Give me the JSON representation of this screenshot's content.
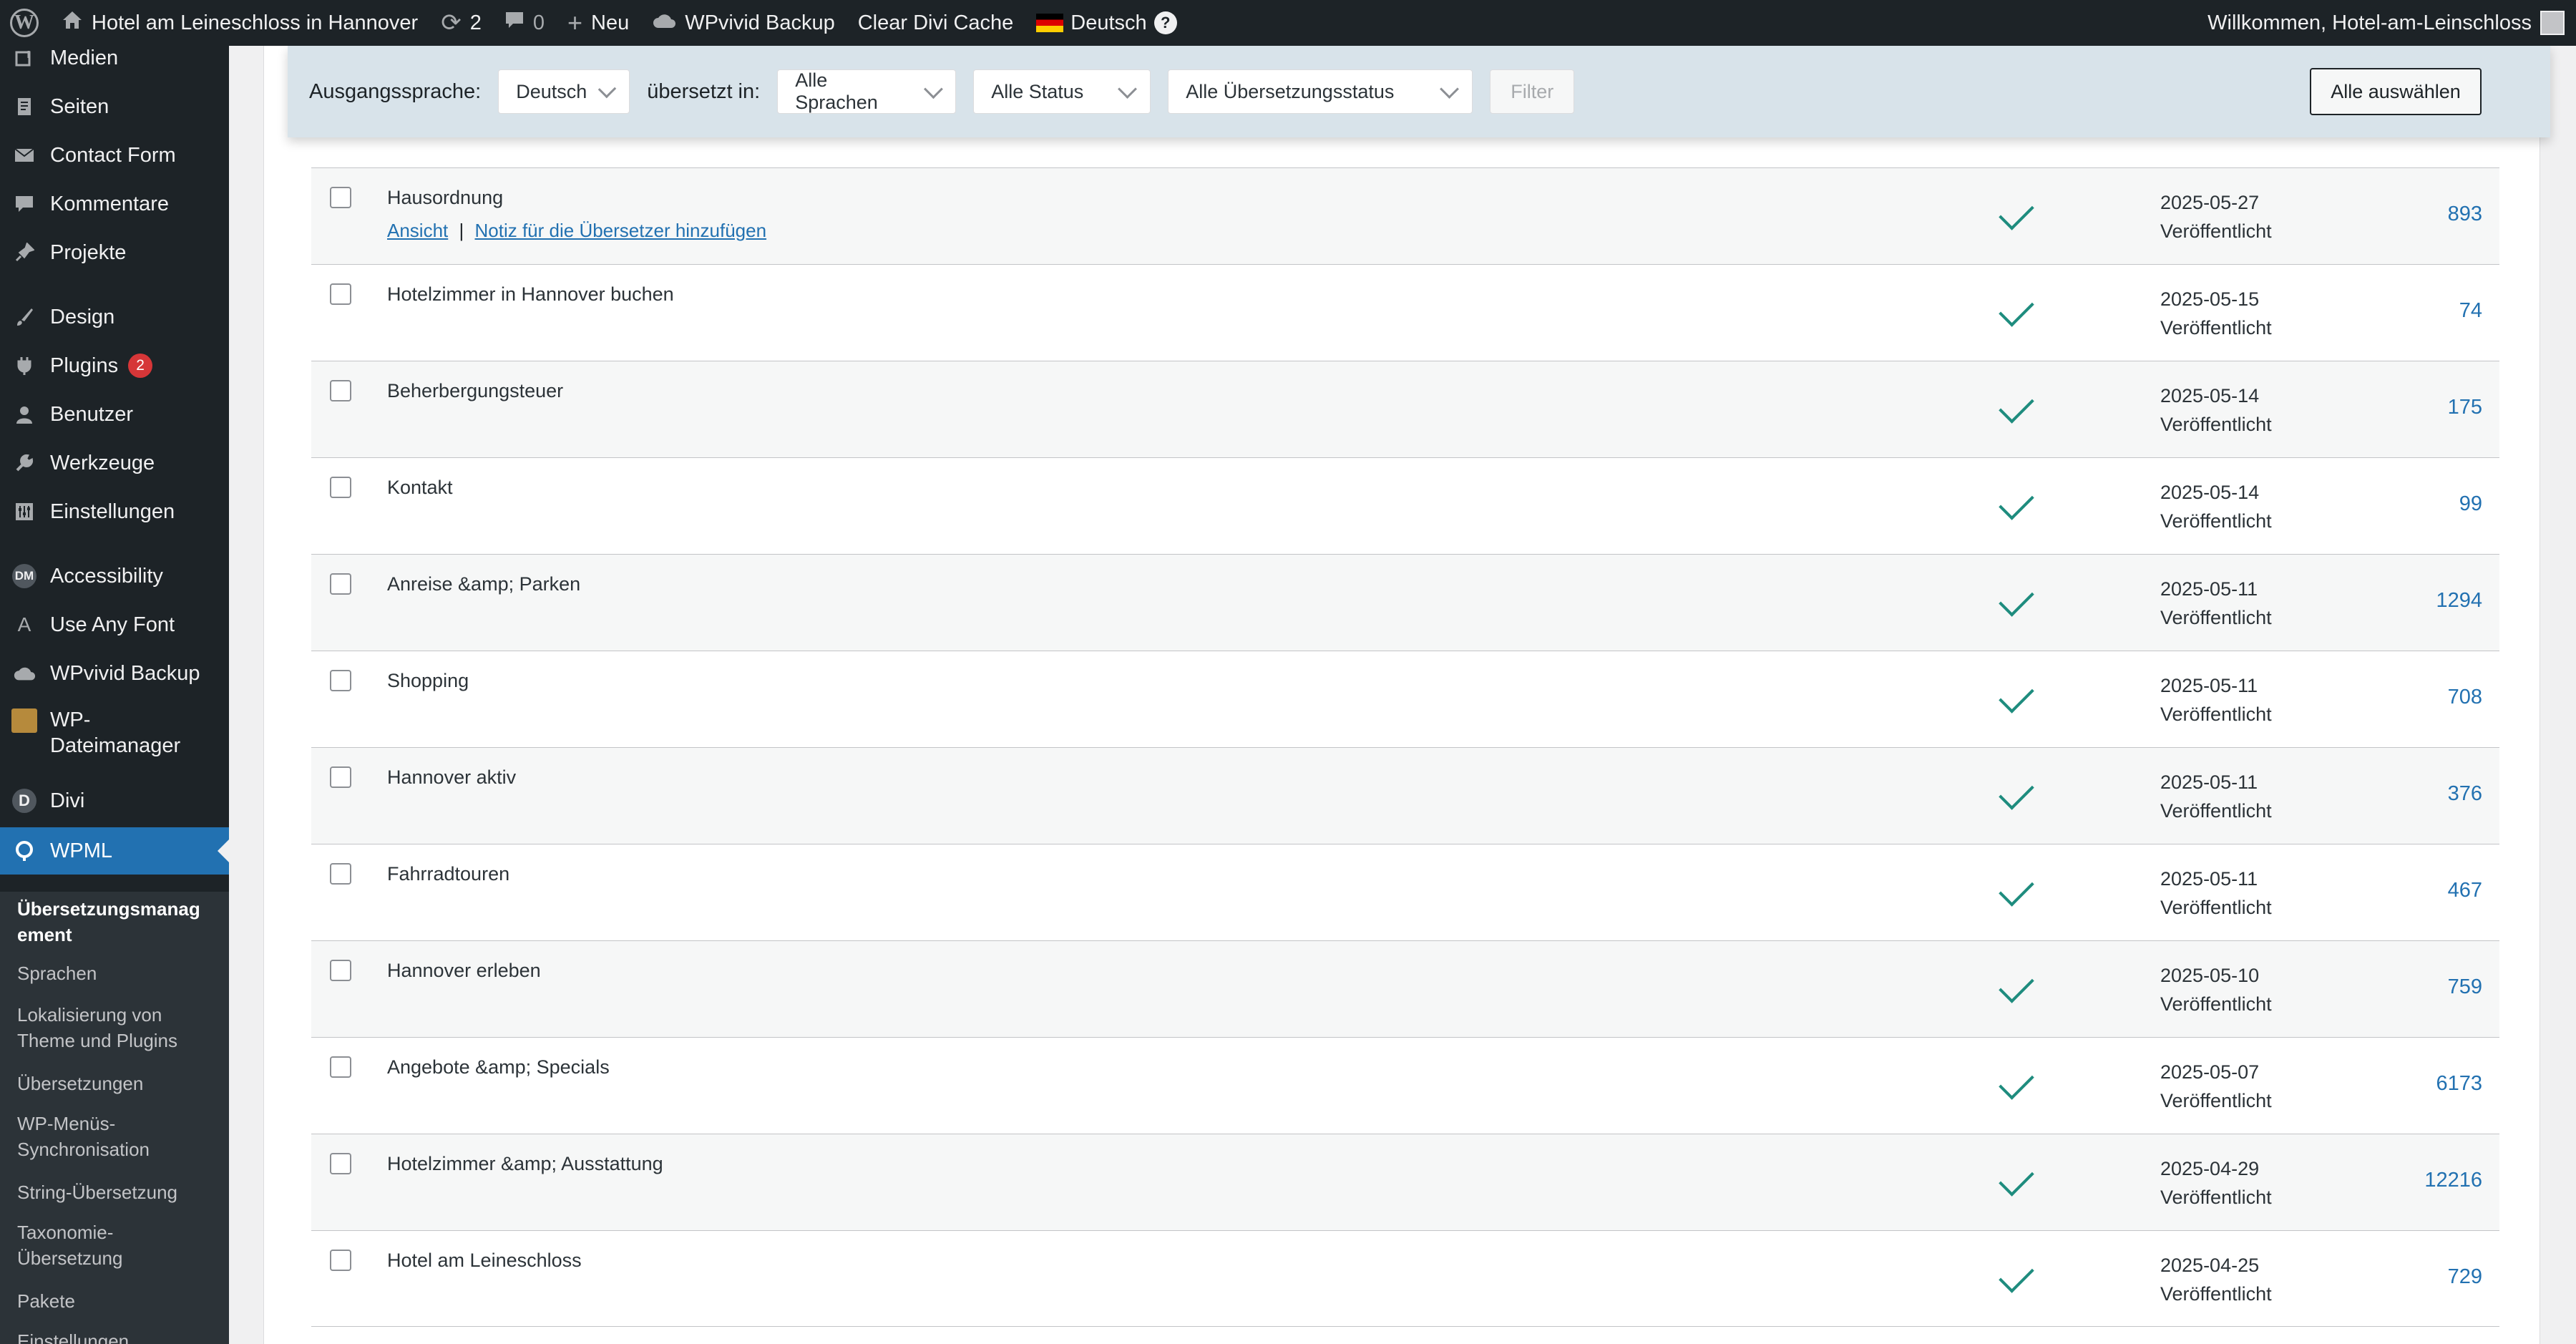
{
  "adminbar": {
    "site_name": "Hotel am Leineschloss in Hannover",
    "updates_count": "2",
    "comments_count": "0",
    "new_label": "Neu",
    "backup_label": "WPvivid Backup",
    "cache_label": "Clear Divi Cache",
    "language_label": "Deutsch",
    "help_label": "?",
    "welcome": "Willkommen, Hotel-am-Leinschloss"
  },
  "sidebar": {
    "items": [
      {
        "label": "Medien",
        "icon": "media-icon"
      },
      {
        "label": "Seiten",
        "icon": "pages-icon"
      },
      {
        "label": "Contact Form",
        "icon": "mail-icon"
      },
      {
        "label": "Kommentare",
        "icon": "comments-icon"
      },
      {
        "label": "Projekte",
        "icon": "pin-icon"
      },
      {
        "label": "Design",
        "icon": "brush-icon"
      },
      {
        "label": "Plugins",
        "icon": "plugin-icon",
        "badge": "2"
      },
      {
        "label": "Benutzer",
        "icon": "user-icon"
      },
      {
        "label": "Werkzeuge",
        "icon": "wrench-icon"
      },
      {
        "label": "Einstellungen",
        "icon": "settings-icon"
      },
      {
        "label": "Accessibility",
        "icon": "dm-icon",
        "icon_text": "DM"
      },
      {
        "label": "Use Any Font",
        "icon": "font-icon",
        "icon_text": "A"
      },
      {
        "label": "WPvivid Backup",
        "icon": "cloud-icon"
      },
      {
        "label": "WP-",
        "label2": "Dateimanager",
        "icon": "file-manager-icon"
      },
      {
        "label": "Divi",
        "icon": "divi-icon",
        "icon_text": "D"
      },
      {
        "label": "WPML",
        "icon": "wpml-icon"
      }
    ],
    "submenu": [
      {
        "label": "Übersetzungsmanag",
        "label2": "ement"
      },
      {
        "label": "Sprachen"
      },
      {
        "label": "Lokalisierung von",
        "label2": "Theme und Plugins"
      },
      {
        "label": "Übersetzungen"
      },
      {
        "label": "WP-Menüs-",
        "label2": "Synchronisation"
      },
      {
        "label": "String-Übersetzung"
      },
      {
        "label": "Taxonomie-",
        "label2": "Übersetzung"
      },
      {
        "label": "Pakete"
      },
      {
        "label": "Einstellungen"
      }
    ]
  },
  "filters": {
    "source_label": "Ausgangssprache:",
    "source_value": "Deutsch",
    "translated_label": "übersetzt in:",
    "languages_value": "Alle Sprachen",
    "status_value": "Alle Status",
    "translation_status_value": "Alle Übersetzungsstatus",
    "filter_button": "Filter",
    "select_all_button": "Alle auswählen"
  },
  "row_actions": {
    "view": "Ansicht",
    "separator": "|",
    "note": "Notiz für die Übersetzer hinzufügen"
  },
  "rows": [
    {
      "title": "Hausordnung",
      "date": "2025-05-27",
      "status": "Veröffentlicht",
      "words": "893"
    },
    {
      "title": "Hotelzimmer in Hannover buchen",
      "date": "2025-05-15",
      "status": "Veröffentlicht",
      "words": "74"
    },
    {
      "title": "Beherbergungsteuer",
      "date": "2025-05-14",
      "status": "Veröffentlicht",
      "words": "175"
    },
    {
      "title": "Kontakt",
      "date": "2025-05-14",
      "status": "Veröffentlicht",
      "words": "99"
    },
    {
      "title": "Anreise &amp; Parken",
      "date": "2025-05-11",
      "status": "Veröffentlicht",
      "words": "1294"
    },
    {
      "title": "Shopping",
      "date": "2025-05-11",
      "status": "Veröffentlicht",
      "words": "708"
    },
    {
      "title": "Hannover aktiv",
      "date": "2025-05-11",
      "status": "Veröffentlicht",
      "words": "376"
    },
    {
      "title": "Fahrradtouren",
      "date": "2025-05-11",
      "status": "Veröffentlicht",
      "words": "467"
    },
    {
      "title": "Hannover erleben",
      "date": "2025-05-10",
      "status": "Veröffentlicht",
      "words": "759"
    },
    {
      "title": "Angebote &amp; Specials",
      "date": "2025-05-07",
      "status": "Veröffentlicht",
      "words": "6173"
    },
    {
      "title": "Hotelzimmer &amp; Ausstattung",
      "date": "2025-04-29",
      "status": "Veröffentlicht",
      "words": "12216"
    },
    {
      "title": "Hotel am Leineschloss",
      "date": "2025-04-25",
      "status": "Veröffentlicht",
      "words": "729"
    }
  ]
}
